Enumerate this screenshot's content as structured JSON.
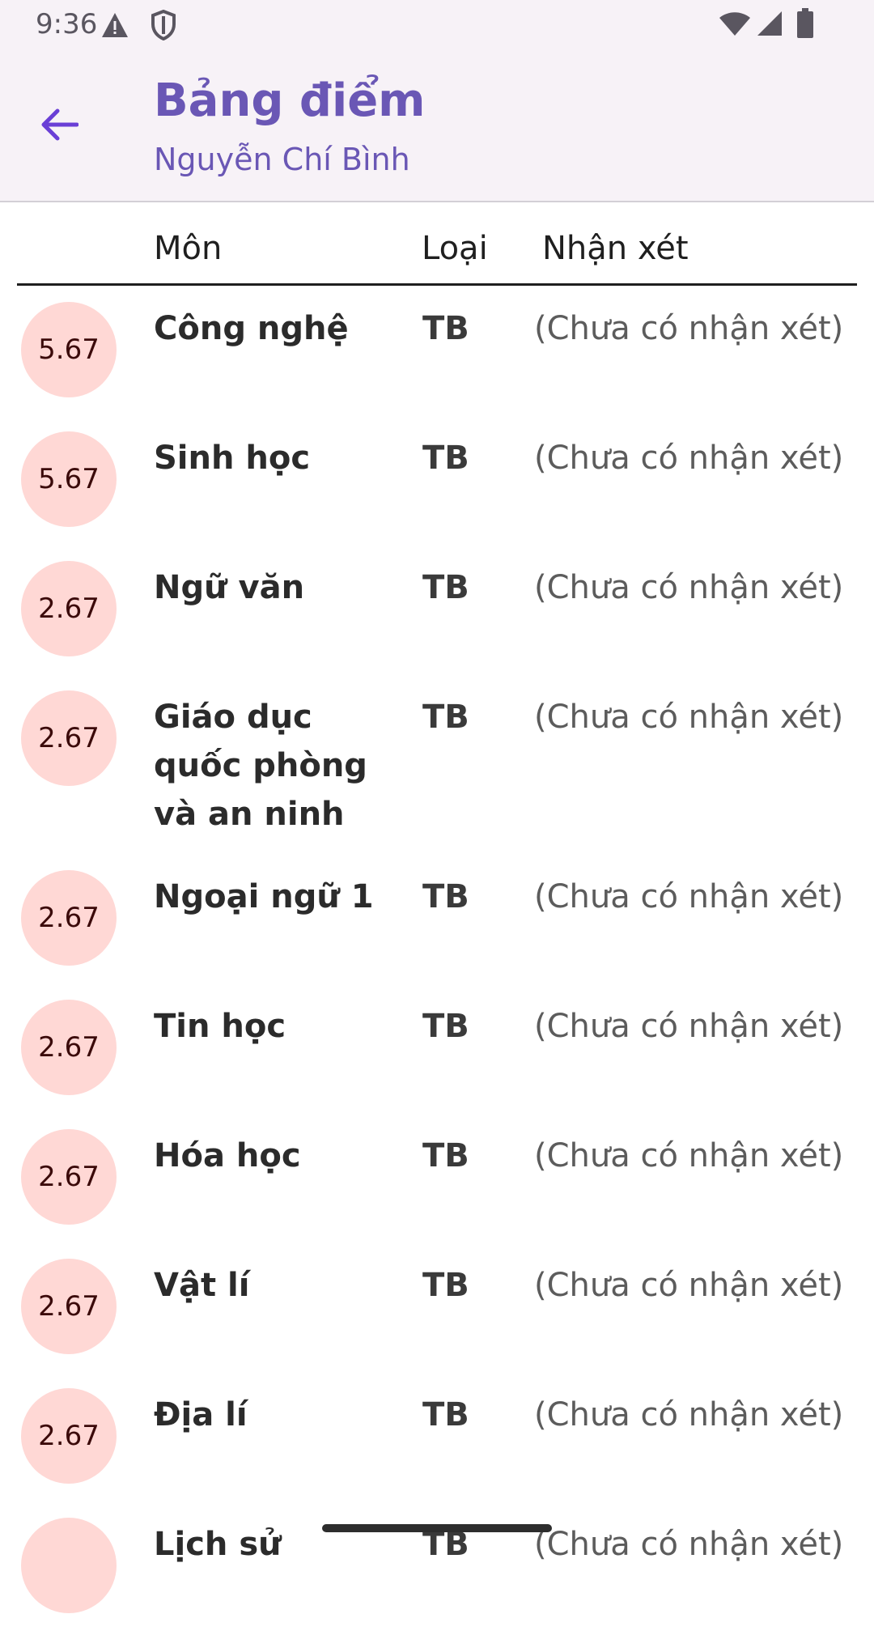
{
  "status_bar": {
    "time": "9:36",
    "icons": [
      "warning-icon",
      "shield-icon",
      "wifi-icon",
      "signal-icon",
      "battery-icon"
    ]
  },
  "app_bar": {
    "back_icon": "arrow-left-icon",
    "title": "Bảng điểm",
    "subtitle": "Nguyễn Chí Bình"
  },
  "table": {
    "headers": {
      "subject": "Môn",
      "type": "Loại",
      "comment": "Nhận xét"
    },
    "rows": [
      {
        "score": "5.67",
        "subject": "Công nghệ",
        "type": "TB",
        "comment": "(Chưa có nhận xét)"
      },
      {
        "score": "5.67",
        "subject": "Sinh học",
        "type": "TB",
        "comment": "(Chưa có nhận xét)"
      },
      {
        "score": "2.67",
        "subject": "Ngữ văn",
        "type": "TB",
        "comment": "(Chưa có nhận xét)"
      },
      {
        "score": "2.67",
        "subject": "Giáo dục quốc phòng và an ninh",
        "type": "TB",
        "comment": "(Chưa có nhận xét)"
      },
      {
        "score": "2.67",
        "subject": "Ngoại ngữ 1",
        "type": "TB",
        "comment": "(Chưa có nhận xét)"
      },
      {
        "score": "2.67",
        "subject": "Tin học",
        "type": "TB",
        "comment": "(Chưa có nhận xét)"
      },
      {
        "score": "2.67",
        "subject": "Hóa học",
        "type": "TB",
        "comment": "(Chưa có nhận xét)"
      },
      {
        "score": "2.67",
        "subject": "Vật lí",
        "type": "TB",
        "comment": "(Chưa có nhận xét)"
      },
      {
        "score": "2.67",
        "subject": "Địa lí",
        "type": "TB",
        "comment": "(Chưa có nhận xét)"
      },
      {
        "score": "",
        "subject": "Lịch sử",
        "type": "TB",
        "comment": "(Chưa có nhận xét)"
      }
    ]
  },
  "colors": {
    "primary": "#6a57b5",
    "badge_bg": "#ffd8d5",
    "app_bar_bg": "#f7f2f7"
  }
}
